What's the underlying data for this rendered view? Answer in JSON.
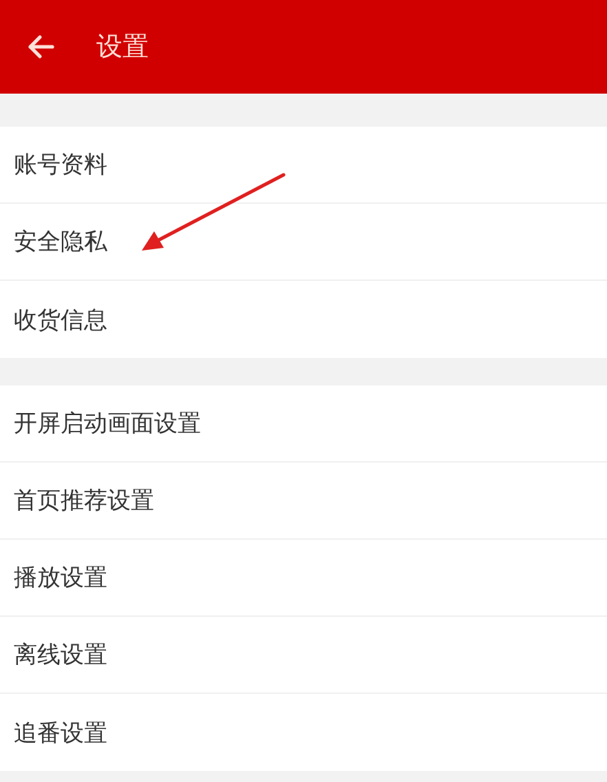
{
  "header": {
    "title": "设置"
  },
  "groups": [
    {
      "items": [
        "账号资料",
        "安全隐私",
        "收货信息"
      ]
    },
    {
      "items": [
        "开屏启动画面设置",
        "首页推荐设置",
        "播放设置",
        "离线设置",
        "追番设置"
      ]
    }
  ]
}
